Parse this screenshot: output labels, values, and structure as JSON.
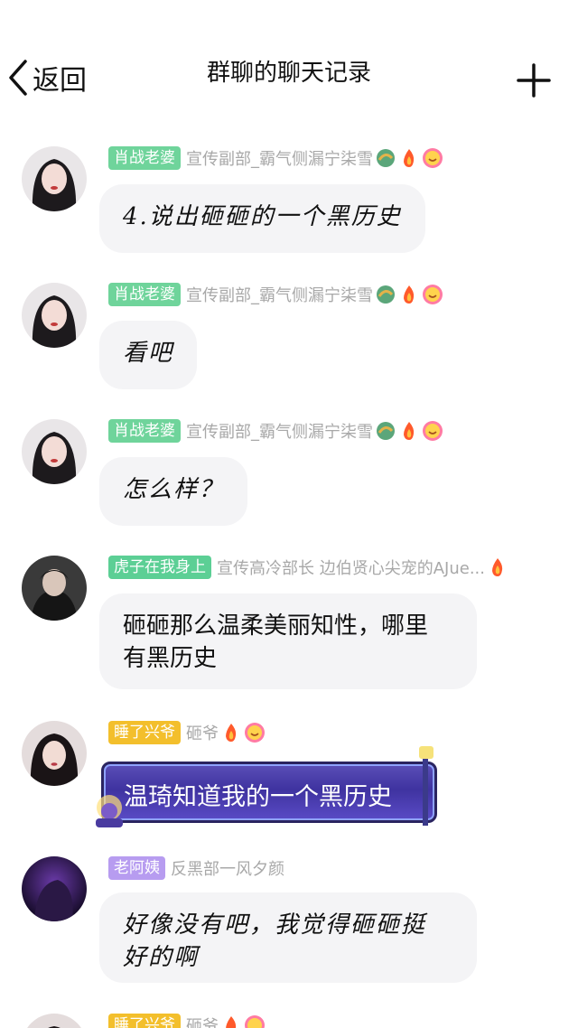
{
  "nav": {
    "back_label": "返回",
    "title": "群聊的聊天记录"
  },
  "messages": [
    {
      "tag": "肖战老婆",
      "title": "宣传副部_霸气侧漏宁柒雪",
      "text": "4.说出砸砸的一个黑历史"
    },
    {
      "tag": "肖战老婆",
      "title": "宣传副部_霸气侧漏宁柒雪",
      "text": "看吧"
    },
    {
      "tag": "肖战老婆",
      "title": "宣传副部_霸气侧漏宁柒雪",
      "text": "怎么样？"
    },
    {
      "tag": "虎子在我身上",
      "title": "宣传高冷部长  边伯贤心尖宠的AJue...",
      "text_line1": "砸砸那么温柔美丽知性，哪里",
      "text_line2": "有黑历史"
    },
    {
      "tag": "睡了兴爷",
      "title": "砸爷",
      "text": "温琦知道我的一个黑历史"
    },
    {
      "tag": "老阿姨",
      "title": "反黑部一风夕颜",
      "text_line1": "好像没有吧，我觉得砸砸挺",
      "text_line2": "好的啊"
    },
    {
      "tag": "睡了兴爷",
      "title": "砸爷"
    }
  ],
  "colors": {
    "green_tag": "#6fd49b",
    "yellow_tag": "#f3bf2c",
    "purple_tag": "#b79cf0",
    "bubble_bg": "#f4f4f6"
  },
  "icons": [
    "chevron-left-icon",
    "plus-icon",
    "dragon-badge-icon",
    "fire-badge-icon",
    "smile-badge-icon"
  ]
}
